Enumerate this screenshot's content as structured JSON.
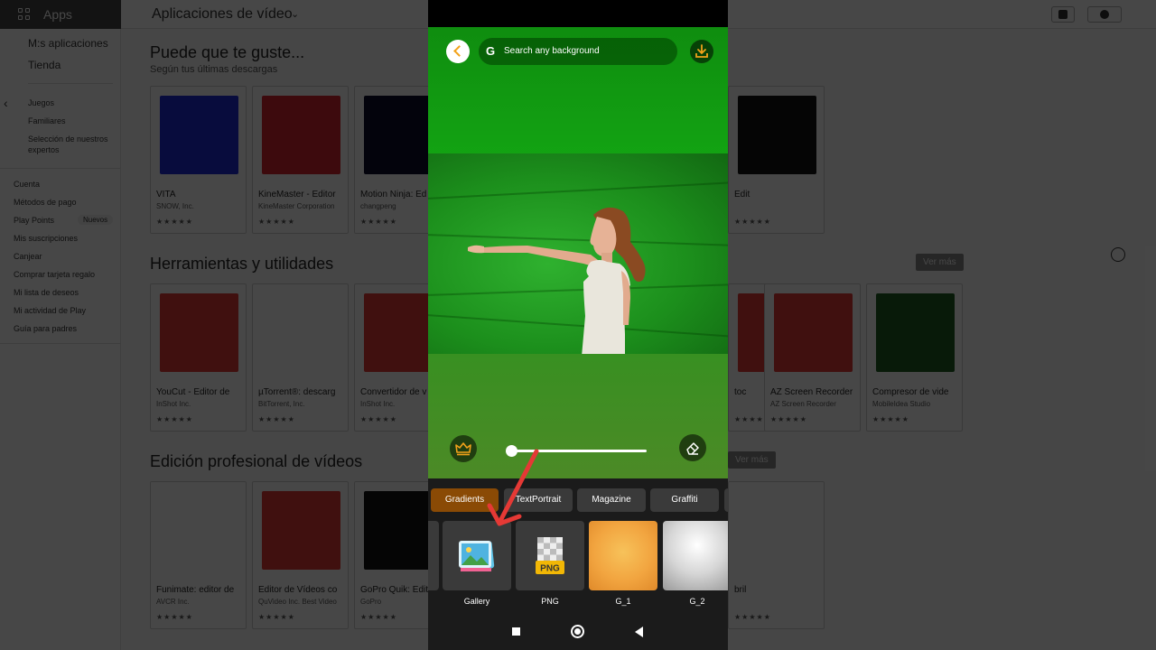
{
  "store": {
    "apps_label": "Apps",
    "category_title": "Aplicaciones de vídeo",
    "sidebar": {
      "my_apps": "M:s aplicaciones",
      "store": "Tienda",
      "games": "Juegos",
      "family": "Familiares",
      "experts": "Selección de nuestros expertos",
      "account_items": [
        "Cuenta",
        "Métodos de pago",
        "Play Points",
        "Mis suscripciones",
        "Canjear",
        "Comprar tarjeta regalo",
        "Mi lista de deseos",
        "Mi actividad de Play",
        "Guía para padres"
      ],
      "new_badge": "Nuevos"
    },
    "section1": {
      "title": "Puede que te guste...",
      "subtitle": "Según tus últimas descargas",
      "cards": [
        {
          "name": "VITA",
          "dev": "SNOW, Inc.",
          "color": "#1b2ad9"
        },
        {
          "name": "KineMaster - Editor",
          "dev": "KineMaster Corporation",
          "color": "#d9232e"
        },
        {
          "name": "Motion Ninja: Ed",
          "dev": "changpeng",
          "color": "#0a0a2a"
        },
        {
          "name": "Edit",
          "dev": "",
          "color": "#111111"
        }
      ]
    },
    "section2": {
      "title": "Herramientas y utilidades",
      "see_more": "Ver más",
      "cards": [
        {
          "name": "YouCut - Editor de",
          "dev": "InShot Inc.",
          "color": "#e53935"
        },
        {
          "name": "µTorrent®: descarg",
          "dev": "BitTorrent, Inc.",
          "color": "#ffffff"
        },
        {
          "name": "Convertidor de v",
          "dev": "InShot Inc.",
          "color": "#e53935"
        },
        {
          "name": "toc",
          "dev": "",
          "color": "#e53935"
        },
        {
          "name": "AZ Screen Recorder",
          "dev": "AZ Screen Recorder",
          "color": "#e53935"
        },
        {
          "name": "Compresor de vide",
          "dev": "MobileIdea Studio",
          "color": "#1b5e20"
        }
      ]
    },
    "section3": {
      "title": "Edición profesional de vídeos",
      "see_more": "Ver más",
      "cards": [
        {
          "name": "Funimate: editor de",
          "dev": "AVCR Inc.",
          "color": "#ffffff"
        },
        {
          "name": "Editor de Vídeos co",
          "dev": "QuVideo Inc. Best Video",
          "color": "#e53935"
        },
        {
          "name": "GoPro Quik: Edit",
          "dev": "GoPro",
          "color": "#111111"
        },
        {
          "name": "bril",
          "dev": "",
          "color": "#ffffff"
        }
      ]
    },
    "stars": "★★★★★"
  },
  "editor": {
    "search_placeholder": "Search any background",
    "google_glyph": "G",
    "tabs": [
      "Gradients",
      "TextPortrait",
      "Magazine",
      "Graffiti"
    ],
    "active_tab": "Gradients",
    "slider_value": 0,
    "thumbnails": [
      {
        "label": "Gallery",
        "icon": "gallery-icon"
      },
      {
        "label": "PNG",
        "icon": "png-icon"
      },
      {
        "label": "G_1",
        "color": "#f2a540"
      },
      {
        "label": "G_2",
        "color": "#e8e8e8"
      }
    ],
    "png_badge": "PNG",
    "accent_color": "#f2a21a",
    "arrow_color": "#e53935"
  }
}
